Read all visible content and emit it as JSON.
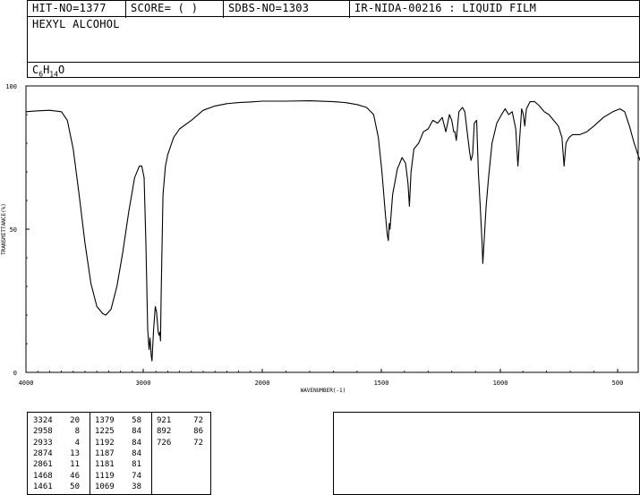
{
  "header": {
    "hit_no": "HIT-NO=1377",
    "score": "SCORE=  (    )",
    "sdbs_no": "SDBS-NO=1303",
    "ir_id": "IR-NIDA-00216 : LIQUID FILM"
  },
  "compound": {
    "name": "HEXYL ALCOHOL",
    "formula_c": "C",
    "formula_c_sub": "6",
    "formula_h": "H",
    "formula_h_sub": "14",
    "formula_o": "O"
  },
  "peak_table": [
    [
      "3324",
      "20"
    ],
    [
      "2958",
      "8"
    ],
    [
      "2933",
      "4"
    ],
    [
      "2874",
      "13"
    ],
    [
      "2861",
      "11"
    ],
    [
      "1468",
      "46"
    ],
    [
      "1461",
      "50"
    ],
    [
      "1379",
      "58"
    ],
    [
      "1225",
      "84"
    ],
    [
      "1192",
      "84"
    ],
    [
      "1187",
      "84"
    ],
    [
      "1181",
      "81"
    ],
    [
      "1119",
      "74"
    ],
    [
      "1069",
      "38"
    ],
    [
      "921",
      "72"
    ],
    [
      "892",
      "86"
    ],
    [
      "726",
      "72"
    ]
  ],
  "chart_data": {
    "type": "line",
    "title": "",
    "xlabel": "WAVENUMBER(-1)",
    "ylabel": "TRANSMITTANCE(%)",
    "xlim": [
      4000,
      400
    ],
    "ylim": [
      0,
      100
    ],
    "x_ticks": [
      "4000",
      "3000",
      "2000",
      "1500",
      "1000",
      "500"
    ],
    "y_ticks": [
      "100",
      "50",
      "0"
    ],
    "series": [
      {
        "points": [
          [
            4000,
            91
          ],
          [
            3900,
            91.3
          ],
          [
            3800,
            91.5
          ],
          [
            3700,
            91
          ],
          [
            3650,
            88
          ],
          [
            3600,
            78
          ],
          [
            3550,
            62
          ],
          [
            3500,
            45
          ],
          [
            3450,
            31
          ],
          [
            3400,
            23
          ],
          [
            3350,
            20.5
          ],
          [
            3324,
            20
          ],
          [
            3280,
            22
          ],
          [
            3230,
            30
          ],
          [
            3180,
            42
          ],
          [
            3130,
            56
          ],
          [
            3080,
            68
          ],
          [
            3040,
            72
          ],
          [
            3020,
            72
          ],
          [
            3000,
            68
          ],
          [
            2985,
            45
          ],
          [
            2970,
            15
          ],
          [
            2958,
            8
          ],
          [
            2950,
            12
          ],
          [
            2940,
            6
          ],
          [
            2933,
            4
          ],
          [
            2920,
            15
          ],
          [
            2905,
            23
          ],
          [
            2895,
            21
          ],
          [
            2880,
            14
          ],
          [
            2874,
            13
          ],
          [
            2867,
            14
          ],
          [
            2861,
            11
          ],
          [
            2855,
            28
          ],
          [
            2840,
            62
          ],
          [
            2820,
            72
          ],
          [
            2800,
            76
          ],
          [
            2750,
            82
          ],
          [
            2700,
            85
          ],
          [
            2600,
            88
          ],
          [
            2500,
            91.5
          ],
          [
            2400,
            93
          ],
          [
            2300,
            93.8
          ],
          [
            2200,
            94.2
          ],
          [
            2100,
            94.4
          ],
          [
            2000,
            94.7
          ],
          [
            1900,
            94.7
          ],
          [
            1800,
            94.8
          ],
          [
            1700,
            94.5
          ],
          [
            1650,
            94.2
          ],
          [
            1600,
            93.5
          ],
          [
            1560,
            92.5
          ],
          [
            1530,
            90
          ],
          [
            1510,
            82
          ],
          [
            1495,
            70
          ],
          [
            1480,
            55
          ],
          [
            1472,
            48
          ],
          [
            1468,
            46
          ],
          [
            1464,
            52
          ],
          [
            1461,
            50
          ],
          [
            1450,
            62
          ],
          [
            1430,
            71
          ],
          [
            1410,
            75
          ],
          [
            1395,
            73
          ],
          [
            1385,
            66
          ],
          [
            1379,
            58
          ],
          [
            1372,
            70
          ],
          [
            1360,
            78
          ],
          [
            1340,
            80
          ],
          [
            1320,
            84
          ],
          [
            1300,
            85
          ],
          [
            1280,
            88
          ],
          [
            1260,
            87
          ],
          [
            1240,
            89
          ],
          [
            1225,
            84
          ],
          [
            1210,
            90
          ],
          [
            1200,
            88
          ],
          [
            1192,
            84
          ],
          [
            1187,
            84
          ],
          [
            1181,
            81
          ],
          [
            1170,
            91
          ],
          [
            1155,
            92.5
          ],
          [
            1145,
            91
          ],
          [
            1135,
            84
          ],
          [
            1125,
            77
          ],
          [
            1119,
            74
          ],
          [
            1112,
            76
          ],
          [
            1105,
            87
          ],
          [
            1095,
            88
          ],
          [
            1088,
            70
          ],
          [
            1080,
            58
          ],
          [
            1072,
            45
          ],
          [
            1069,
            38
          ],
          [
            1064,
            45
          ],
          [
            1055,
            58
          ],
          [
            1045,
            68
          ],
          [
            1030,
            80
          ],
          [
            1010,
            87
          ],
          [
            990,
            90
          ],
          [
            975,
            92
          ],
          [
            960,
            90
          ],
          [
            945,
            91
          ],
          [
            930,
            85
          ],
          [
            921,
            72
          ],
          [
            915,
            80
          ],
          [
            905,
            92
          ],
          [
            898,
            90
          ],
          [
            892,
            86
          ],
          [
            885,
            92
          ],
          [
            870,
            94.5
          ],
          [
            850,
            94.5
          ],
          [
            830,
            93
          ],
          [
            810,
            91
          ],
          [
            790,
            90
          ],
          [
            770,
            88
          ],
          [
            750,
            86
          ],
          [
            735,
            82
          ],
          [
            726,
            72
          ],
          [
            718,
            80
          ],
          [
            705,
            82
          ],
          [
            690,
            83
          ],
          [
            660,
            83
          ],
          [
            630,
            84
          ],
          [
            600,
            86
          ],
          [
            560,
            89
          ],
          [
            520,
            91
          ],
          [
            490,
            92
          ],
          [
            470,
            91
          ],
          [
            450,
            86
          ],
          [
            430,
            80
          ],
          [
            410,
            75
          ],
          [
            400,
            73
          ]
        ]
      }
    ]
  }
}
